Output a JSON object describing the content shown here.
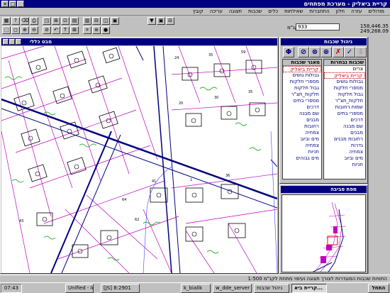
{
  "window": {
    "title": "קריית ביאליק - מערכת מפתחים"
  },
  "menu": [
    "קובץ",
    "עריכה",
    "תצוגה",
    "שכבות",
    "כלים",
    "שאילתות",
    "התחברות",
    "חלון",
    "עזרה",
    "מודולים"
  ],
  "toolbar": {
    "row1": [
      "▦",
      "?",
      "⌫",
      "⎙",
      "◳",
      "⊞",
      "⊡",
      "▤",
      "▥",
      "⊟",
      "◫",
      "▣"
    ],
    "row2": [
      "⬚",
      "◻",
      "⊕",
      "⊖",
      "⊘",
      "↶",
      "T",
      "⊠",
      "⌗",
      "⊛",
      "●"
    ],
    "row3": [
      "▼",
      "▣",
      "⊟"
    ]
  },
  "scale": {
    "label": "1 :קנ\"מ",
    "value": "933"
  },
  "coords": {
    "x": "158,446.35",
    "y": "249,268.09"
  },
  "map_window": {
    "title": "מבט כללי"
  },
  "layer_window": {
    "title": "ניהול שכבות"
  },
  "layer_buttons": [
    "✓",
    "✗",
    "⊕",
    "⊗",
    "⊘",
    "Φ"
  ],
  "layer_lists": {
    "right_header": "שכבות נבחרות",
    "left_header": "מאגר שכבות",
    "right_items": [
      "קריית ביאליק",
      "גבולות גושים",
      "מספרי חלקות",
      "גבול חלקות",
      "חלקות_תצ\"ר",
      "מספרי בתים",
      "דרכים",
      "שם מבנה",
      "מבנים",
      "רחובות",
      "צמחיה",
      "מים וביוב",
      "צמחיה",
      "חניות",
      "מים גבוהים"
    ],
    "left_items": [
      "צרים",
      "קריית ביאליק",
      "גבולות גושים",
      "מספרי חלקות",
      "גבול חלקות",
      "חלקות_תצ\"ר",
      "שמות רחובות",
      "מספרי בתים",
      "דרכים",
      "שם מבנה",
      "מבנים",
      "רחובות מבנים",
      "גדרות",
      "צמחיה",
      "מים וביוב",
      "חניות"
    ]
  },
  "overview": {
    "title": "מפת סביבה"
  },
  "status": {
    "text": "התוויות שכבות המוגדרות לצורך תצוגה ועיפוי מתחת לקנ\"מ 1:500"
  },
  "taskbar": {
    "clock": "07:43",
    "tasks": [
      "Unified - Ima",
      "[JS] 8:2901",
      "k_bialik",
      "w_dde_server",
      "ניהול שכבות",
      "קריית ביא..."
    ],
    "start": "התחל"
  },
  "colors": {
    "titlebar": "#000080",
    "parcel": "#c000c0",
    "road": "#000080",
    "vegetation": "#00a000"
  }
}
